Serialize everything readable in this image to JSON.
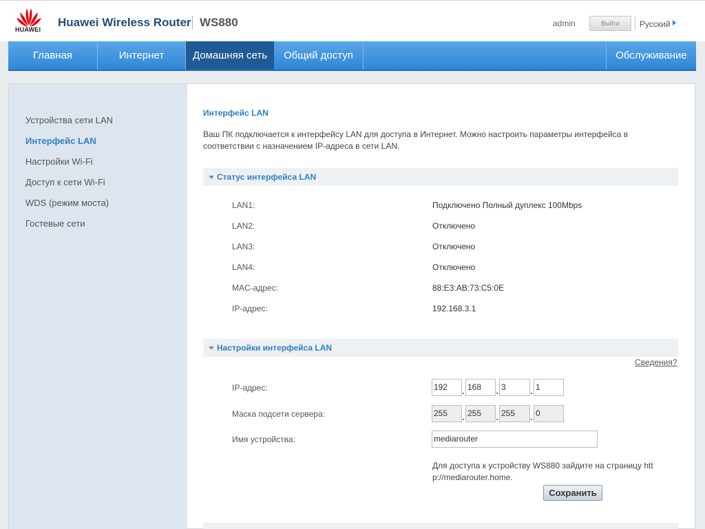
{
  "header": {
    "brand": "HUAWEI",
    "app_title": "Huawei Wireless Router",
    "model": "WS880",
    "user": "admin",
    "logout_label": "Выйти",
    "language": "Русский",
    "brand_color": "#e60012"
  },
  "nav": {
    "items": [
      {
        "label": "Главная"
      },
      {
        "label": "Интернет"
      },
      {
        "label": "Домашняя сеть"
      },
      {
        "label": "Общий доступ"
      },
      {
        "label": "Обслуживание"
      }
    ],
    "active": "Домашняя сеть"
  },
  "sidebar": {
    "items": [
      {
        "label": "Устройства сети LAN"
      },
      {
        "label": "Интерфейс LAN"
      },
      {
        "label": "Настройки Wi-Fi"
      },
      {
        "label": "Доступ к сети Wi-Fi"
      },
      {
        "label": "WDS (режим моста)"
      },
      {
        "label": "Гостевые сети"
      }
    ],
    "active": "Интерфейс LAN"
  },
  "main": {
    "title": "Интерфейс LAN",
    "description": "Ваш ПК подключается к интерфейсу LAN для доступа в Интернет. Можно настроить параметры интерфейса в соответствии с назначением IP-адреса в сети LAN.",
    "status_section": {
      "title": "Статус интерфейса LAN",
      "rows": [
        {
          "label": "LAN1:",
          "value": "Подключено Полный дуплекс 100Mbps"
        },
        {
          "label": "LAN2:",
          "value": "Отключено"
        },
        {
          "label": "LAN3:",
          "value": "Отключено"
        },
        {
          "label": "LAN4:",
          "value": "Отключено"
        },
        {
          "label": "MAC-адрес:",
          "value": "88:E3:AB:73:C5:0E"
        },
        {
          "label": "IP-адрес:",
          "value": "192.168.3.1"
        }
      ]
    },
    "settings_section": {
      "title": "Настройки интерфейса LAN",
      "help_link": "Сведения?",
      "ip_label": "IP-адрес:",
      "ip_octets": [
        "192",
        "168",
        "3",
        "1"
      ],
      "mask_label": "Маска подсети сервера:",
      "mask_octets": [
        "255",
        "255",
        "255",
        "0"
      ],
      "device_name_label": "Имя устройства:",
      "device_name_value": "mediarouter",
      "hint": "Для доступа к устройству WS880 зайдите на страницу htt p://mediarouter.home.",
      "save_label": "Сохранить"
    }
  }
}
